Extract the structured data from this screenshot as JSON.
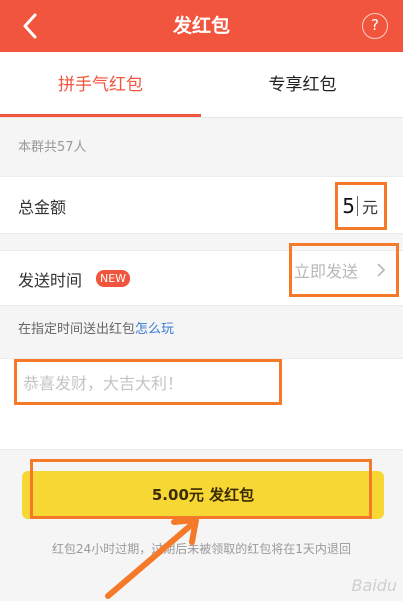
{
  "header": {
    "title": "发红包",
    "back_icon": "chevron-left-icon",
    "help_label": "?"
  },
  "tabs": [
    {
      "label": "拼手气红包",
      "active": true
    },
    {
      "label": "专享红包",
      "active": false
    }
  ],
  "group_info": "本群共57人",
  "amount": {
    "label": "总金额",
    "value": "5",
    "unit": "元"
  },
  "send_time": {
    "label": "发送时间",
    "badge": "NEW",
    "value": "立即发送"
  },
  "hint": {
    "text": "在指定时间送出红包",
    "link": "怎么玩"
  },
  "message": {
    "placeholder": "恭喜发财，大吉大利！"
  },
  "send_button": {
    "label": "5.00元 发红包"
  },
  "footnote": "红包24小时过期，过期后未被领取的红包将在1天内退回",
  "colors": {
    "brand": "#f2553d",
    "button": "#f7d734",
    "annotation": "#f47a2a",
    "link": "#3a7bd5"
  }
}
